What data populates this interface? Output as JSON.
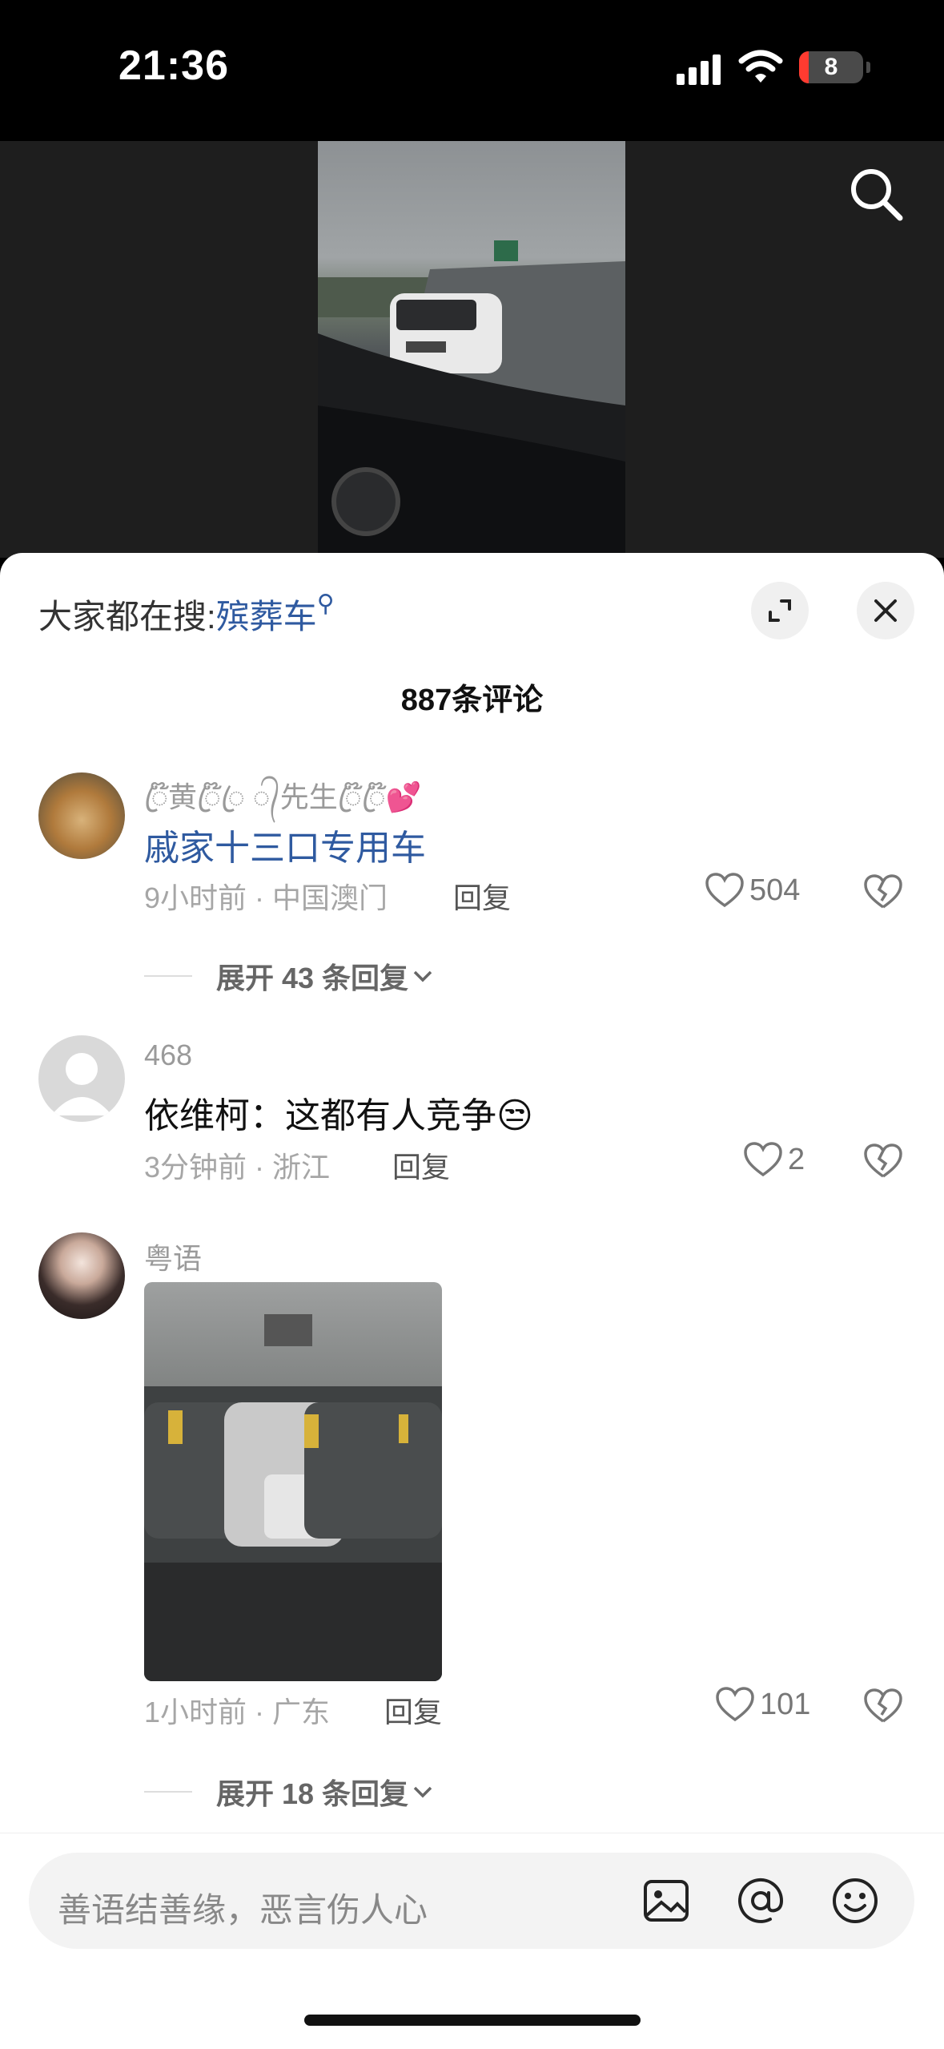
{
  "status_bar": {
    "time": "21:36",
    "battery": "8"
  },
  "sheet": {
    "hot_search_label": "大家都在搜:",
    "hot_search_term": "殡葬车",
    "comment_count": "887条评论"
  },
  "comments": [
    {
      "username": "ꦿ໊黄ꦿ໊ꦿ ᭄先生ꦿ໊ꦿ໊💕",
      "text": "戚家十三口专用车",
      "time_location": "9小时前 · 中国澳门",
      "reply_label": "回复",
      "likes": "504",
      "expand_label": "展开 43 条回复"
    },
    {
      "username": "468",
      "text": "依维柯：这都有人竞争😒",
      "time_location": "3分钟前 · 浙江",
      "reply_label": "回复",
      "likes": "2"
    },
    {
      "username": "粤语",
      "time_location": "1小时前 · 广东",
      "reply_label": "回复",
      "likes": "101",
      "expand_label": "展开 18 条回复"
    }
  ],
  "input": {
    "placeholder": "善语结善缘，恶言伤人心"
  },
  "icons": [
    "search-icon",
    "expand-icon",
    "close-icon",
    "heart-icon",
    "broken-heart-icon",
    "image-icon",
    "at-icon",
    "emoji-icon",
    "chevron-down-icon",
    "wifi-icon",
    "signal-icon",
    "battery-icon"
  ]
}
